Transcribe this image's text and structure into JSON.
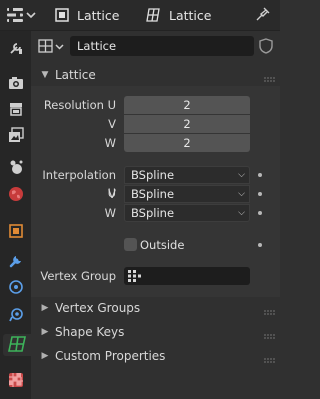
{
  "header": {
    "object_name": "Lattice",
    "data_name": "Lattice"
  },
  "datablock": {
    "name": "Lattice"
  },
  "lattice_panel": {
    "title": "Lattice",
    "resolution_u_label": "Resolution U",
    "resolution_v_label": "V",
    "resolution_w_label": "W",
    "resolution_u": "2",
    "resolution_v": "2",
    "resolution_w": "2",
    "interp_u_label": "Interpolation U",
    "interp_v_label": "V",
    "interp_w_label": "W",
    "interp_u": "BSpline",
    "interp_v": "BSpline",
    "interp_w": "BSpline",
    "outside_label": "Outside",
    "outside_checked": false,
    "vertex_group_label": "Vertex Group",
    "vertex_group_value": ""
  },
  "collapsed_panels": {
    "vertex_groups": "Vertex Groups",
    "shape_keys": "Shape Keys",
    "custom_properties": "Custom Properties"
  },
  "colors": {
    "accent_green": "#3db35a",
    "panel_bg": "#353535",
    "field_bg": "#545454"
  }
}
